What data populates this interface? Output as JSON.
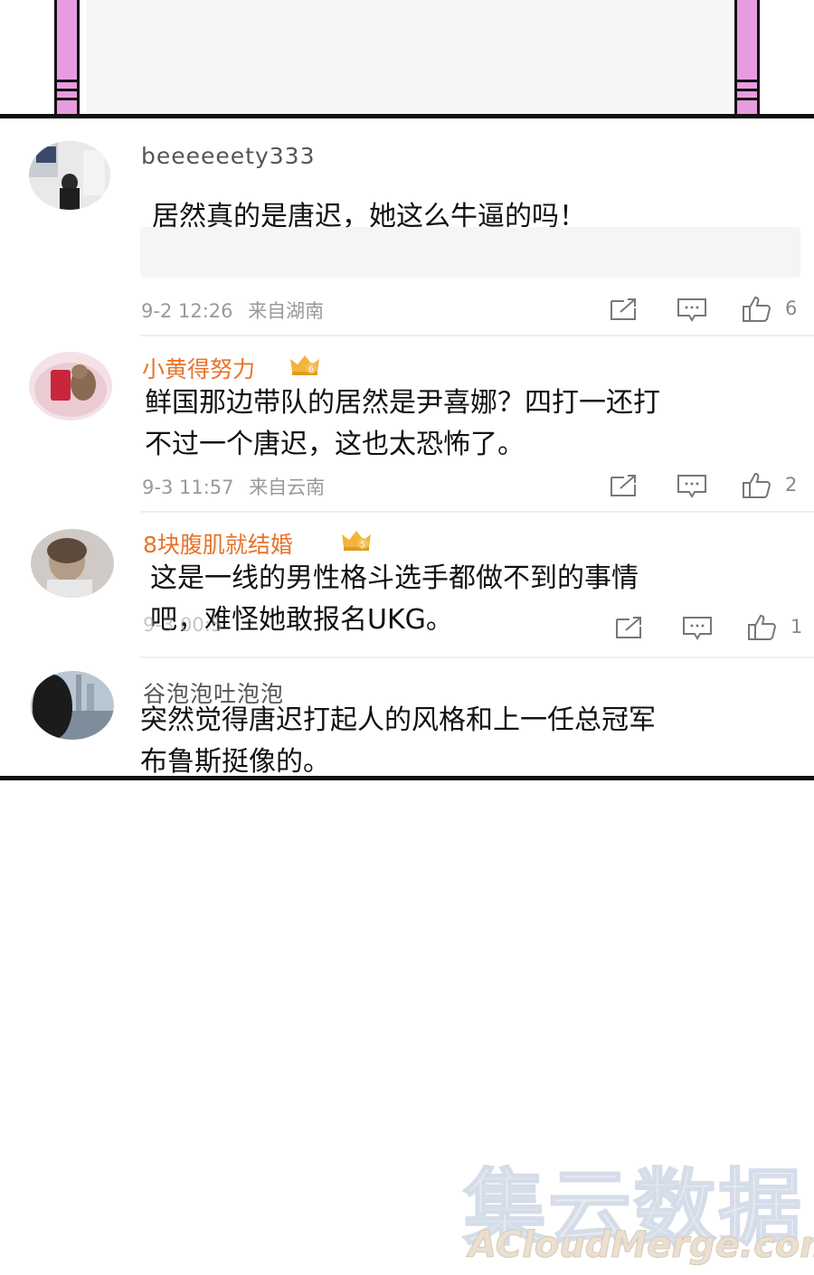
{
  "comments": [
    {
      "username": "beeeeeety333",
      "vip": false,
      "text_lines": [
        "居然真的是唐迟，她这么牛逼的吗！"
      ],
      "time": "9-2 12:26",
      "location": "来自湖南",
      "likes": "6"
    },
    {
      "username": "小黄得努力",
      "vip": true,
      "text_lines": [
        "鲜国那边带队的居然是尹喜娜？四打一还打",
        "不过一个唐迟，这也太恐怖了。"
      ],
      "time": "9-3 11:57",
      "location": "来自云南",
      "likes": "2"
    },
    {
      "username": "8块腹肌就结婚",
      "vip": true,
      "text_lines": [
        "这是一线的男性格斗选手都做不到的事情",
        "吧，难怪她敢报名UKG。"
      ],
      "time": "9-3 00:5",
      "location": "",
      "likes": "1"
    },
    {
      "username": "谷泡泡吐泡泡",
      "vip": false,
      "text_lines": [
        "突然觉得唐迟打起人的风格和上一任总冠军",
        "布鲁斯挺像的。"
      ]
    }
  ],
  "actions": {
    "share_icon": "share-icon",
    "reply_icon": "comment-icon",
    "like_icon": "thumbs-up-icon"
  },
  "watermark": {
    "cn": "集云数据",
    "en": "ACloudMerge.com"
  },
  "colors": {
    "vip_name": "#e8722a",
    "pillar": "#e79be0",
    "border": "#111111"
  }
}
